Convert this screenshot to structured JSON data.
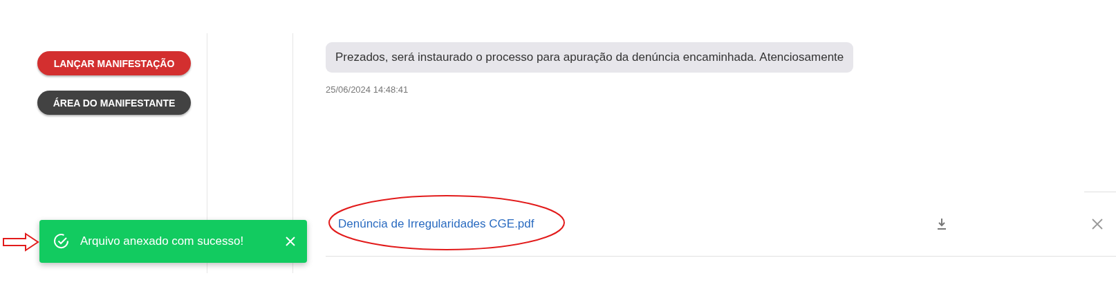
{
  "sidebar": {
    "buttons": [
      {
        "label": "LANÇAR MANIFESTAÇÃO",
        "kind": "primary"
      },
      {
        "label": "ÁREA DO MANIFESTANTE",
        "kind": "dark"
      }
    ]
  },
  "message": {
    "text": "Prezados, será instaurado o processo para apuração da denúncia encaminhada. Atenciosamente",
    "timestamp": "25/06/2024 14:48:41"
  },
  "attachment": {
    "filename": "Denúncia de Irregularidades CGE.pdf"
  },
  "toast": {
    "message": "Arquivo anexado com sucesso!"
  }
}
